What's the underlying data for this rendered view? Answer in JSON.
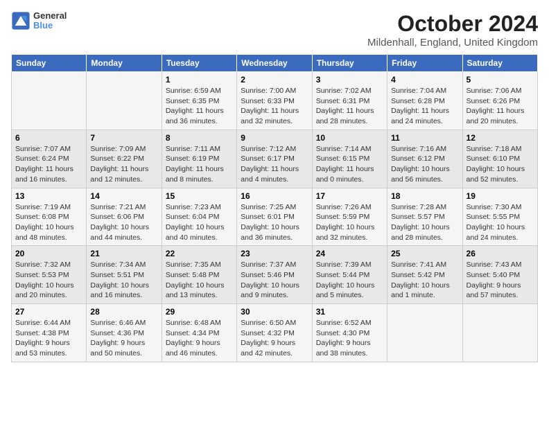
{
  "logo": {
    "line1": "General",
    "line2": "Blue"
  },
  "title": "October 2024",
  "subtitle": "Mildenhall, England, United Kingdom",
  "days_of_week": [
    "Sunday",
    "Monday",
    "Tuesday",
    "Wednesday",
    "Thursday",
    "Friday",
    "Saturday"
  ],
  "weeks": [
    [
      {
        "day": "",
        "info": ""
      },
      {
        "day": "",
        "info": ""
      },
      {
        "day": "1",
        "info": "Sunrise: 6:59 AM\nSunset: 6:35 PM\nDaylight: 11 hours and 36 minutes."
      },
      {
        "day": "2",
        "info": "Sunrise: 7:00 AM\nSunset: 6:33 PM\nDaylight: 11 hours and 32 minutes."
      },
      {
        "day": "3",
        "info": "Sunrise: 7:02 AM\nSunset: 6:31 PM\nDaylight: 11 hours and 28 minutes."
      },
      {
        "day": "4",
        "info": "Sunrise: 7:04 AM\nSunset: 6:28 PM\nDaylight: 11 hours and 24 minutes."
      },
      {
        "day": "5",
        "info": "Sunrise: 7:06 AM\nSunset: 6:26 PM\nDaylight: 11 hours and 20 minutes."
      }
    ],
    [
      {
        "day": "6",
        "info": "Sunrise: 7:07 AM\nSunset: 6:24 PM\nDaylight: 11 hours and 16 minutes."
      },
      {
        "day": "7",
        "info": "Sunrise: 7:09 AM\nSunset: 6:22 PM\nDaylight: 11 hours and 12 minutes."
      },
      {
        "day": "8",
        "info": "Sunrise: 7:11 AM\nSunset: 6:19 PM\nDaylight: 11 hours and 8 minutes."
      },
      {
        "day": "9",
        "info": "Sunrise: 7:12 AM\nSunset: 6:17 PM\nDaylight: 11 hours and 4 minutes."
      },
      {
        "day": "10",
        "info": "Sunrise: 7:14 AM\nSunset: 6:15 PM\nDaylight: 11 hours and 0 minutes."
      },
      {
        "day": "11",
        "info": "Sunrise: 7:16 AM\nSunset: 6:12 PM\nDaylight: 10 hours and 56 minutes."
      },
      {
        "day": "12",
        "info": "Sunrise: 7:18 AM\nSunset: 6:10 PM\nDaylight: 10 hours and 52 minutes."
      }
    ],
    [
      {
        "day": "13",
        "info": "Sunrise: 7:19 AM\nSunset: 6:08 PM\nDaylight: 10 hours and 48 minutes."
      },
      {
        "day": "14",
        "info": "Sunrise: 7:21 AM\nSunset: 6:06 PM\nDaylight: 10 hours and 44 minutes."
      },
      {
        "day": "15",
        "info": "Sunrise: 7:23 AM\nSunset: 6:04 PM\nDaylight: 10 hours and 40 minutes."
      },
      {
        "day": "16",
        "info": "Sunrise: 7:25 AM\nSunset: 6:01 PM\nDaylight: 10 hours and 36 minutes."
      },
      {
        "day": "17",
        "info": "Sunrise: 7:26 AM\nSunset: 5:59 PM\nDaylight: 10 hours and 32 minutes."
      },
      {
        "day": "18",
        "info": "Sunrise: 7:28 AM\nSunset: 5:57 PM\nDaylight: 10 hours and 28 minutes."
      },
      {
        "day": "19",
        "info": "Sunrise: 7:30 AM\nSunset: 5:55 PM\nDaylight: 10 hours and 24 minutes."
      }
    ],
    [
      {
        "day": "20",
        "info": "Sunrise: 7:32 AM\nSunset: 5:53 PM\nDaylight: 10 hours and 20 minutes."
      },
      {
        "day": "21",
        "info": "Sunrise: 7:34 AM\nSunset: 5:51 PM\nDaylight: 10 hours and 16 minutes."
      },
      {
        "day": "22",
        "info": "Sunrise: 7:35 AM\nSunset: 5:48 PM\nDaylight: 10 hours and 13 minutes."
      },
      {
        "day": "23",
        "info": "Sunrise: 7:37 AM\nSunset: 5:46 PM\nDaylight: 10 hours and 9 minutes."
      },
      {
        "day": "24",
        "info": "Sunrise: 7:39 AM\nSunset: 5:44 PM\nDaylight: 10 hours and 5 minutes."
      },
      {
        "day": "25",
        "info": "Sunrise: 7:41 AM\nSunset: 5:42 PM\nDaylight: 10 hours and 1 minute."
      },
      {
        "day": "26",
        "info": "Sunrise: 7:43 AM\nSunset: 5:40 PM\nDaylight: 9 hours and 57 minutes."
      }
    ],
    [
      {
        "day": "27",
        "info": "Sunrise: 6:44 AM\nSunset: 4:38 PM\nDaylight: 9 hours and 53 minutes."
      },
      {
        "day": "28",
        "info": "Sunrise: 6:46 AM\nSunset: 4:36 PM\nDaylight: 9 hours and 50 minutes."
      },
      {
        "day": "29",
        "info": "Sunrise: 6:48 AM\nSunset: 4:34 PM\nDaylight: 9 hours and 46 minutes."
      },
      {
        "day": "30",
        "info": "Sunrise: 6:50 AM\nSunset: 4:32 PM\nDaylight: 9 hours and 42 minutes."
      },
      {
        "day": "31",
        "info": "Sunrise: 6:52 AM\nSunset: 4:30 PM\nDaylight: 9 hours and 38 minutes."
      },
      {
        "day": "",
        "info": ""
      },
      {
        "day": "",
        "info": ""
      }
    ]
  ]
}
